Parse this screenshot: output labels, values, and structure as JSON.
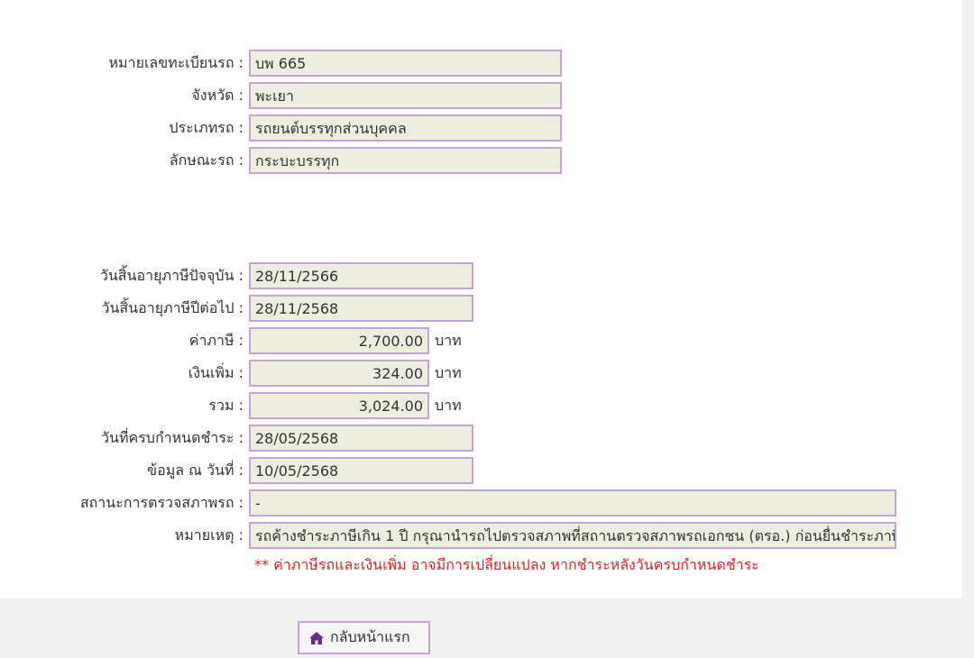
{
  "vehicle": {
    "plate_label": "หมายเลขทะเบียนรถ :",
    "plate_value": "บพ 665",
    "province_label": "จังหวัด :",
    "province_value": "พะเยา",
    "type_label": "ประเภทรถ :",
    "type_value": "รถยนต์บรรทุกส่วนบุคคล",
    "style_label": "ลักษณะรถ :",
    "style_value": "กระบะบรรทุก"
  },
  "tax": {
    "current_expiry_label": "วันสิ้นอายุภาษีปัจจุบัน :",
    "current_expiry_value": "28/11/2566",
    "next_expiry_label": "วันสิ้นอายุภาษีปีต่อไป :",
    "next_expiry_value": "28/11/2568",
    "tax_label": "ค่าภาษี :",
    "tax_value": "2,700.00",
    "surcharge_label": "เงินเพิ่ม :",
    "surcharge_value": "324.00",
    "total_label": "รวม :",
    "total_value": "3,024.00",
    "currency_unit": "บาท",
    "due_date_label": "วันที่ครบกำหนดชำระ :",
    "due_date_value": "28/05/2568",
    "data_date_label": "ข้อมูล ณ วันที่ :",
    "data_date_value": "10/05/2568",
    "inspection_label": "สถานะการตรวจสภาพรถ :",
    "inspection_value": "-",
    "remark_label": "หมายเหตุ :",
    "remark_value": "รถค้างชำระภาษีเกิน 1 ปี กรุณานำรถไปตรวจสภาพที่สถานตรวจสภาพรถเอกชน (ตรอ.) ก่อนยื่นชำระภาษี"
  },
  "warning_text": "** ค่าภาษีรถและเงินเพิ่ม อาจมีการเปลี่ยนแปลง หากชำระหลังวันครบกำหนดชำระ",
  "home_button": {
    "label": "กลับหน้าแรก",
    "icon": "home-icon",
    "icon_color": "#6a2c82"
  },
  "colors": {
    "field_border": "#c6a3d6",
    "field_background": "#eeeee0",
    "warning": "#e02020"
  }
}
